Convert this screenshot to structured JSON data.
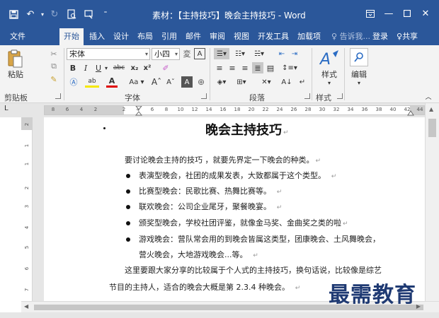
{
  "window": {
    "title": "素材：【主持技巧】晚会主持技巧 - Word"
  },
  "tabs": [
    {
      "label": "文件"
    },
    {
      "label": "开始"
    },
    {
      "label": "插入"
    },
    {
      "label": "设计"
    },
    {
      "label": "布局"
    },
    {
      "label": "引用"
    },
    {
      "label": "邮件"
    },
    {
      "label": "审阅"
    },
    {
      "label": "视图"
    },
    {
      "label": "开发工具"
    },
    {
      "label": "加载项"
    },
    {
      "label": "告诉我..."
    },
    {
      "label": "登录"
    },
    {
      "label": "共享"
    }
  ],
  "ribbon": {
    "paste_label": "粘贴",
    "font_name": "宋体",
    "font_size": "小四",
    "style_label": "样式",
    "edit_label": "编辑",
    "groups": {
      "clipboard": "剪贴板",
      "font": "字体",
      "paragraph": "段落",
      "styles": "样式"
    }
  },
  "ruler": {
    "corner": "L",
    "ticks": [
      "8",
      "6",
      "4",
      "2",
      "2",
      "4",
      "6",
      "8",
      "10",
      "12",
      "14",
      "16",
      "18",
      "20",
      "22",
      "24",
      "26",
      "28",
      "30",
      "32",
      "34",
      "36",
      "38",
      "40",
      "42",
      "44"
    ],
    "vticks": [
      "2",
      "1",
      "1",
      "2",
      "3",
      "4",
      "5",
      "6",
      "7",
      "8"
    ]
  },
  "document": {
    "title": "晚会主持技巧",
    "intro": "要讨论晚会主持的技巧 ，就要先界定一下晚会的种类。",
    "bullets": [
      "表演型晚会，社团的成果发表，大致都属于这个类型。",
      "比赛型晚会：民歌比赛、热舞比赛等。",
      "联欢晚会：公司企业尾牙，聚餐晚宴。",
      "颁奖型晚会，学校社团评鉴，就像金马奖、金曲奖之类的啦",
      "游戏晚会：营队常会用的到晚会皆属这类型，团康晚会、土风舞晚会，"
    ],
    "bullet_continuation": "营火晚会，大地游戏晚会...等。",
    "para2_line1": "这里要跟大家分享的比较属于个人式的主持技巧，换句话说，比较像是综艺",
    "para2_line2": "节目的主持人，适合的晚会大概是第 2.3.4 种晚会。"
  },
  "watermark": "最需教育"
}
